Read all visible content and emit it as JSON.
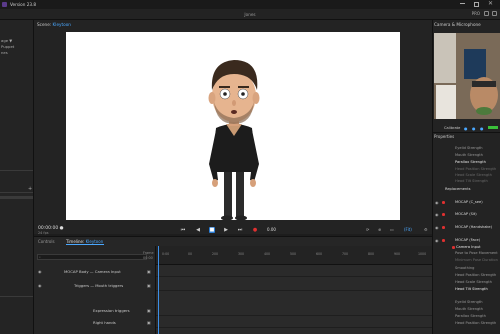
{
  "window": {
    "title": "Version 23.8"
  },
  "menu": {
    "center_title": "Jones",
    "pro_label": "PRO"
  },
  "left_panel": {
    "items": [
      "age ▼",
      "Puppet",
      "nes"
    ]
  },
  "scene": {
    "tab_prefix": "Scene:",
    "tab_name": "Kleytoon"
  },
  "transport": {
    "timecode": "00:00:00",
    "timecode_suffix": "●",
    "fps": "24 fps",
    "time_value": "0.00",
    "zoom": "(Fit)"
  },
  "timeline": {
    "tabs": [
      {
        "label": "Controls"
      },
      {
        "label": "Timeline:",
        "name": "Kleytoon"
      }
    ],
    "frames_label": "Frame",
    "seconds_label": "00:00",
    "ticks": [
      "0:00",
      "00",
      "200",
      "300",
      "400",
      "500",
      "600",
      "700",
      "800",
      "900",
      "1000"
    ],
    "rows": [
      {
        "label": "MOCAP Body  —  Camera Input"
      },
      {
        "label": "Triggers  —  Mouth triggers"
      },
      {
        "label": "Expression triggers"
      },
      {
        "label": "Right hands"
      }
    ]
  },
  "camera_panel": {
    "title": "Camera & Microphone",
    "calibrate": "Calibrate"
  },
  "properties": {
    "title": "Properties",
    "group1": [
      "Eyelid Strength",
      "Mouth Strength",
      "Parallax Strength",
      "Head Position Strength",
      "Head Scale Strength",
      "Head Tilt Strength"
    ],
    "replacements": "Replacements",
    "sections": [
      "MOCAP (C_see)",
      "MOCAP (Sit)",
      "MOCAP (Handshake)",
      "MOCAP (Face)"
    ],
    "face_items": [
      "Camera Input",
      "Pose to Pose Movement",
      "Minimum Pose Duration",
      "Smoothing",
      "Head Position Strength",
      "Head Scale Strength",
      "Head Tilt Strength"
    ],
    "group2": [
      "Eyelid Strength",
      "Mouth Strength",
      "Parallax Strength",
      "Head Position Strength"
    ]
  }
}
